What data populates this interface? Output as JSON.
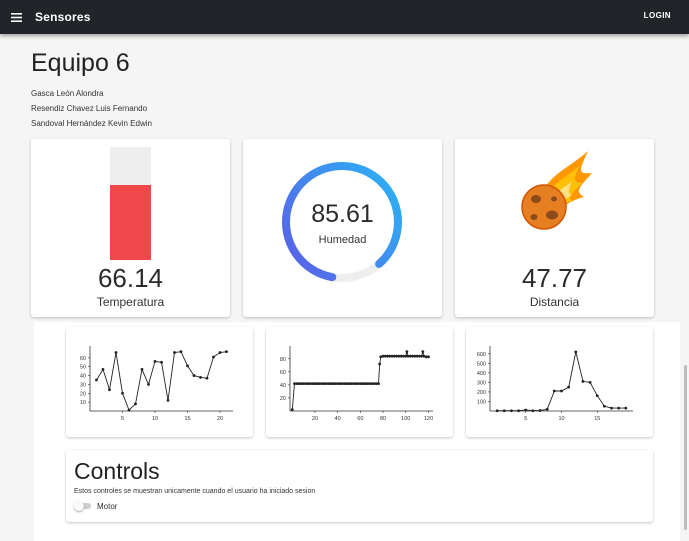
{
  "header": {
    "title": "Sensores",
    "login_label": "LOGIN",
    "menu_icon": "menu-icon"
  },
  "team": {
    "title": "Equipo 6",
    "members": [
      "Gasca León Alondra",
      "Resendiz Chavez Luis Fernando",
      "Sandoval Hernández Kevin Edwin"
    ]
  },
  "sensors": {
    "temperature": {
      "value": "66.14",
      "label": "Temperatura",
      "level": 0.6614,
      "fill_color": "#ef474a",
      "track_color": "#eeeeee"
    },
    "humidity": {
      "value": "85.61",
      "label": "Humedad",
      "level": 0.8561,
      "gradient_start": "#29b6f6",
      "gradient_end": "#5c5ce6"
    },
    "distance": {
      "value": "47.77",
      "label": "Distancia",
      "icon": "flaming-meteor-icon"
    }
  },
  "chart_data": [
    {
      "type": "line",
      "x": [
        1,
        2,
        3,
        4,
        5,
        6,
        7,
        8,
        9,
        10,
        11,
        12,
        13,
        14,
        15,
        16,
        17,
        18,
        19,
        20,
        21
      ],
      "y": [
        35,
        47,
        24,
        66,
        20,
        1,
        8,
        47,
        30,
        56,
        55,
        12,
        66,
        67,
        51,
        40,
        38,
        37,
        61,
        66,
        67
      ],
      "xticks": [
        5,
        10,
        15,
        20
      ],
      "yticks": [
        10,
        20,
        30,
        40,
        50,
        60
      ],
      "xlim": [
        0,
        22
      ],
      "ylim": [
        0,
        70
      ]
    },
    {
      "type": "line",
      "x": [
        0,
        2,
        4,
        6,
        8,
        10,
        12,
        14,
        16,
        18,
        20,
        22,
        24,
        26,
        28,
        30,
        32,
        34,
        36,
        38,
        40,
        42,
        44,
        46,
        48,
        50,
        52,
        54,
        56,
        58,
        60,
        62,
        64,
        66,
        68,
        70,
        72,
        74,
        76,
        77,
        78,
        80,
        82,
        84,
        86,
        88,
        90,
        92,
        94,
        96,
        98,
        100,
        101,
        102,
        104,
        106,
        108,
        110,
        112,
        114,
        115,
        116,
        118,
        120
      ],
      "y": [
        2,
        42,
        42,
        42,
        42,
        42,
        42,
        42,
        42,
        42,
        42,
        42,
        42,
        42,
        42,
        42,
        42,
        42,
        42,
        42,
        42,
        42,
        42,
        42,
        42,
        42,
        42,
        42,
        42,
        42,
        42,
        42,
        42,
        42,
        42,
        42,
        42,
        42,
        42,
        72,
        83,
        84,
        84,
        84,
        84,
        84,
        84,
        84,
        84,
        84,
        84,
        84,
        91,
        84,
        84,
        84,
        84,
        84,
        84,
        84,
        91,
        84,
        83,
        83
      ],
      "xticks": [
        20,
        40,
        60,
        80,
        100,
        120
      ],
      "yticks": [
        20,
        40,
        60,
        80
      ],
      "xlim": [
        -2,
        124
      ],
      "ylim": [
        0,
        95
      ]
    },
    {
      "type": "line",
      "x": [
        1,
        2,
        3,
        4,
        5,
        6,
        7,
        8,
        9,
        10,
        11,
        12,
        13,
        14,
        15,
        16,
        17,
        18,
        19
      ],
      "y": [
        3,
        3,
        3,
        3,
        10,
        3,
        5,
        18,
        210,
        210,
        250,
        620,
        310,
        300,
        160,
        50,
        30,
        30,
        30
      ],
      "xticks": [
        5,
        10,
        15
      ],
      "yticks": [
        100,
        200,
        300,
        400,
        500,
        600
      ],
      "xlim": [
        0,
        20
      ],
      "ylim": [
        0,
        650
      ]
    }
  ],
  "controls": {
    "title": "Controls",
    "description": "Estos controles se muestran unicamente cuando el usuario ha iniciado sesion",
    "motor_label": "Motor",
    "motor_on": false
  }
}
